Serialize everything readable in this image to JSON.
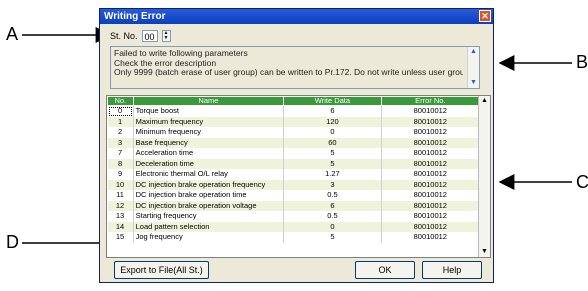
{
  "callouts": {
    "a": "A",
    "b": "B",
    "c": "C",
    "d": "D"
  },
  "dialog": {
    "title": "Writing Error",
    "close_glyph": "✕",
    "station_label": "St. No.",
    "station_value": "00",
    "messages": [
      "Failed to write following parameters",
      "Check the error description",
      "Only 9999 (batch erase of user group) can be written to Pr.172. Do not write unless user group batch"
    ],
    "columns": [
      "No.",
      "Name",
      "Write Data",
      "Error No."
    ],
    "rows": [
      {
        "no": "0",
        "name": "Torque boost",
        "data": "6",
        "err": "80010012"
      },
      {
        "no": "1",
        "name": "Maximum frequency",
        "data": "120",
        "err": "80010012"
      },
      {
        "no": "2",
        "name": "Minimum frequency",
        "data": "0",
        "err": "80010012"
      },
      {
        "no": "3",
        "name": "Base frequency",
        "data": "60",
        "err": "80010012"
      },
      {
        "no": "7",
        "name": "Acceleration time",
        "data": "5",
        "err": "80010012"
      },
      {
        "no": "8",
        "name": "Deceleration time",
        "data": "5",
        "err": "80010012"
      },
      {
        "no": "9",
        "name": "Electronic thermal O/L relay",
        "data": "1.27",
        "err": "80010012"
      },
      {
        "no": "10",
        "name": "DC injection brake operation frequency",
        "data": "3",
        "err": "80010012"
      },
      {
        "no": "11",
        "name": "DC injection brake operation time",
        "data": "0.5",
        "err": "80010012"
      },
      {
        "no": "12",
        "name": "DC injection brake operation voltage",
        "data": "6",
        "err": "80010012"
      },
      {
        "no": "13",
        "name": "Starting frequency",
        "data": "0.5",
        "err": "80010012"
      },
      {
        "no": "14",
        "name": "Load pattern selection",
        "data": "0",
        "err": "80010012"
      },
      {
        "no": "15",
        "name": "Jog frequency",
        "data": "5",
        "err": "80010012"
      }
    ],
    "buttons": {
      "export": "Export to File(All St.)",
      "ok": "OK",
      "help": "Help"
    }
  }
}
